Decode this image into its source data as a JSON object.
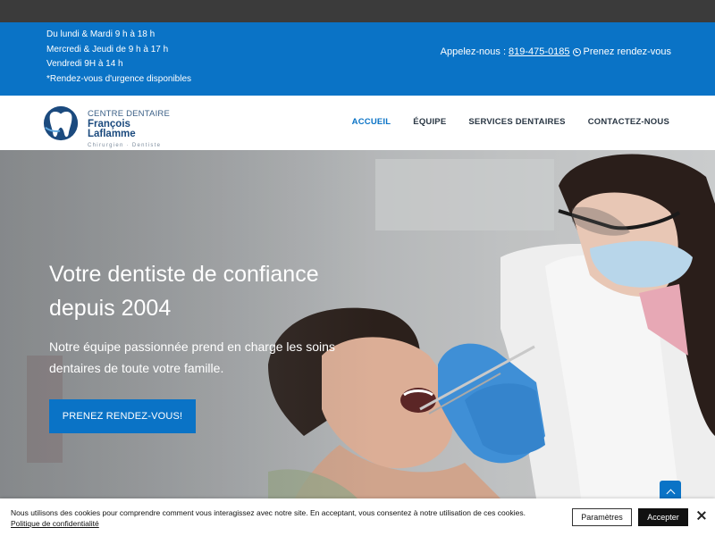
{
  "infobar": {
    "hours": [
      "Du lundi & Mardi 9 h à 18 h",
      "Mercredi & Jeudi de 9 h à 17 h",
      "Vendredi 9H à 14 h",
      "*Rendez-vous d'urgence disponibles"
    ],
    "call_label": "Appelez-nous :",
    "phone": "819-475-0185",
    "appointment_link": "Prenez rendez-vous",
    "appointment_icon": "clock-icon"
  },
  "logo": {
    "line1": "CENTRE DENTAIRE",
    "line2": "François Laflamme",
    "line3": "Chirurgien · Dentiste"
  },
  "nav": {
    "items": [
      "ACCUEIL",
      "ÉQUIPE",
      "SERVICES DENTAIRES",
      "CONTACTEZ-NOUS"
    ],
    "active": "ACCUEIL"
  },
  "hero": {
    "title": "Votre dentiste de confiance depuis 2004",
    "subtitle": "Notre équipe passionnée prend en charge les soins dentaires de toute votre famille.",
    "cta": "PRENEZ RENDEZ-VOUS!"
  },
  "cookie": {
    "text": "Nous utilisons des cookies pour comprendre comment vous interagissez avec notre site. En acceptant, vous consentez à notre utilisation de ces cookies.",
    "policy_link": "Politique de confidentialité",
    "settings_button": "Paramètres",
    "accept_button": "Accepter"
  },
  "colors": {
    "primary": "#0a73c6",
    "top_bar": "#3b3b3b",
    "nav_text": "#2a3744"
  }
}
